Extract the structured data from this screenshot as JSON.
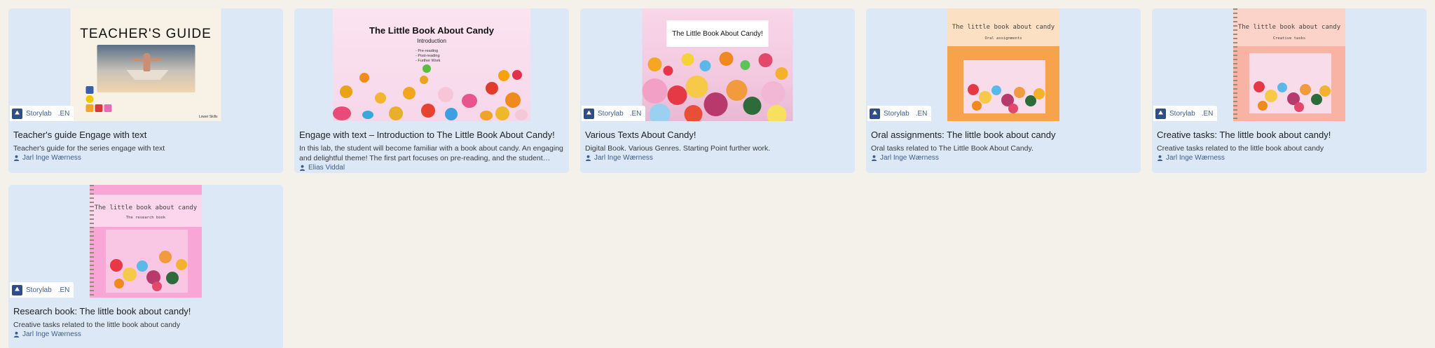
{
  "colors": {
    "page_bg": "#f4f0ea",
    "card_bg": "#dce8f6",
    "accent_text": "#3d5d8f"
  },
  "cards": [
    {
      "title": "Teacher's guide Engage with text",
      "description": "Teacher's guide for the series engage with text",
      "author": "Jarl Inge Wærness",
      "badge": {
        "label": "Storylab",
        "lang": ".EN"
      },
      "thumb": {
        "heading": "TEACHER'S GUIDE",
        "footer": "Lower Skills"
      }
    },
    {
      "title": "Engage with text – Introduction to The Little Book About Candy!",
      "description": "In this lab, the student will become familiar with a book about candy. An engaging and delightful theme! The first part focuses on pre-reading, and the student must…",
      "author": "Elias Viddal",
      "badge": null,
      "thumb": {
        "heading": "The Little Book About Candy",
        "subheading": "Introduction",
        "list": [
          "- Pre-reading",
          "- Post-reading",
          "- Further Work"
        ]
      }
    },
    {
      "title": "Various Texts About Candy!",
      "description": "Digital Book. Various Genres. Starting Point further work.",
      "author": "Jarl Inge Wærness",
      "badge": {
        "label": "Storylab",
        "lang": ".EN"
      },
      "thumb": {
        "heading": "The Little Book About Candy!"
      }
    },
    {
      "title": "Oral assignments: The little book about candy",
      "description": "Oral tasks related to The Little Book About Candy.",
      "author": "Jarl Inge Wærness",
      "badge": {
        "label": "Storylab",
        "lang": ".EN"
      },
      "thumb": {
        "heading": "The little book about candy",
        "subheading": "Oral assignments"
      }
    },
    {
      "title": "Creative tasks: The little book about candy!",
      "description": "Creative tasks related to the little book about candy",
      "author": "Jarl Inge Wærness",
      "badge": {
        "label": "Storylab",
        "lang": ".EN"
      },
      "thumb": {
        "heading": "The little book about candy",
        "subheading": "Creative tasks"
      }
    },
    {
      "title": "Research book: The little book about candy!",
      "description": "Creative tasks related to the little book about candy",
      "author": "Jarl Inge Wærness",
      "badge": {
        "label": "Storylab",
        "lang": ".EN"
      },
      "thumb": {
        "heading": "The little book about candy",
        "subheading": "The research book"
      }
    }
  ]
}
